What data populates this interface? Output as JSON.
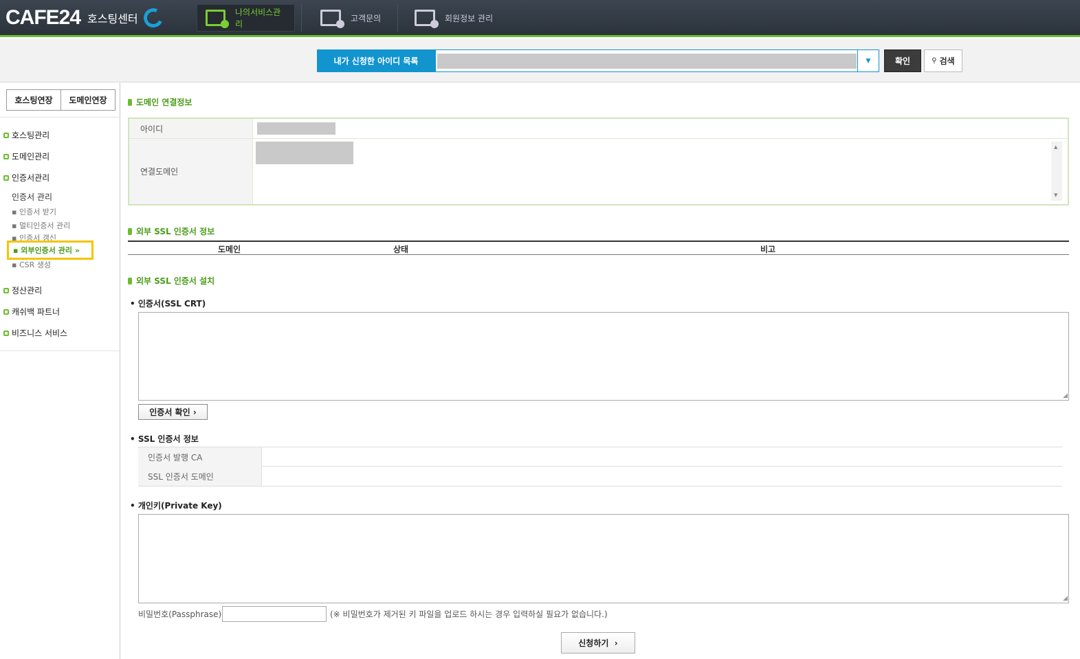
{
  "header": {
    "brand": "CAFE24",
    "brand_sub": "호스팅센터",
    "nav": [
      {
        "label": "나의서비스관리",
        "active": true
      },
      {
        "label": "고객문의",
        "active": false
      },
      {
        "label": "회원정보 관리",
        "active": false
      }
    ]
  },
  "search": {
    "label": "내가 신청한 아이디 목록",
    "confirm_label": "확인",
    "search_label": "검색"
  },
  "sidebar": {
    "renew_hosting": "호스팅연장",
    "renew_domain": "도메인연장",
    "menus": [
      "호스팅관리",
      "도메인관리",
      "인증서관리"
    ],
    "cert_head": "인증서 관리",
    "cert_items": [
      "인증서 받기",
      "멀티인증서 관리",
      "인증서 갱신",
      "외부인증서 관리",
      "CSR 생성"
    ],
    "menus_bottom": [
      "정산관리",
      "캐쉬백 파트너",
      "비즈니스 서비스"
    ]
  },
  "main": {
    "domain_info_title": "도메인 연결정보",
    "id_label": "아이디",
    "linked_domain_label": "연결도메인",
    "ext_ssl_info_title": "외부 SSL 인증서 정보",
    "ext_ssl_cols": [
      "도메인",
      "상태",
      "비고"
    ],
    "ext_ssl_install_title": "외부 SSL 인증서 설치",
    "crt_title": "인증서(SSL CRT)",
    "crt_check_label": "인증서 확인",
    "ssl_info_title": "SSL 인증서 정보",
    "ssl_issuer_label": "인증서 발행 CA",
    "ssl_domain_label": "SSL 인증서 도메인",
    "private_key_title": "개인키(Private Key)",
    "passphrase_label": "비밀번호(Passphrase)",
    "passphrase_note": "(※ 비밀번호가 제거된 키 파일을 업로드 하시는 경우 입력하실 필요가 없습니다.)",
    "apply_label": "신청하기"
  },
  "colors": {
    "accent_green": "#6abe2b",
    "accent_blue": "#1294cf",
    "highlight_yellow": "#f5c400"
  }
}
